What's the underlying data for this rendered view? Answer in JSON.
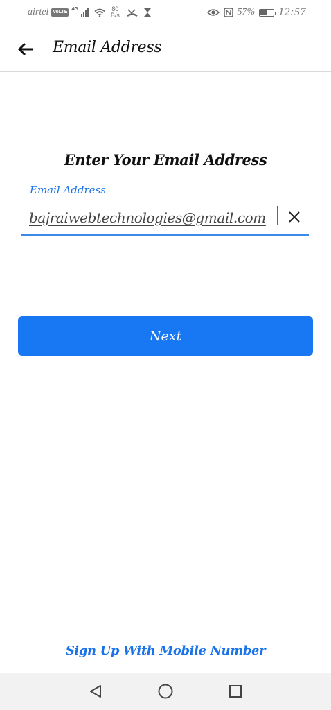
{
  "status_bar": {
    "carrier": "airtel",
    "volte": "VoLTE",
    "network_type": "4G",
    "speed_value": "80",
    "speed_unit": "B/s",
    "battery_percent": "57%",
    "battery_level": 0.57,
    "time": "12:57"
  },
  "app_bar": {
    "title": "Email Address",
    "back_icon": "arrow-left-icon"
  },
  "form": {
    "heading": "Enter Your Email Address",
    "email_label": "Email Address",
    "email_value": "bajraiwebtechnologies@gmail.com",
    "clear_icon": "close-icon"
  },
  "actions": {
    "next_label": "Next",
    "signup_link": "Sign Up With Mobile Number"
  },
  "colors": {
    "accent": "#1a73e8",
    "button": "#1877f2",
    "nav_background": "#f2f2f2"
  },
  "nav_bar": {
    "back": "triangle-back-icon",
    "home": "circle-home-icon",
    "recents": "square-recents-icon"
  }
}
